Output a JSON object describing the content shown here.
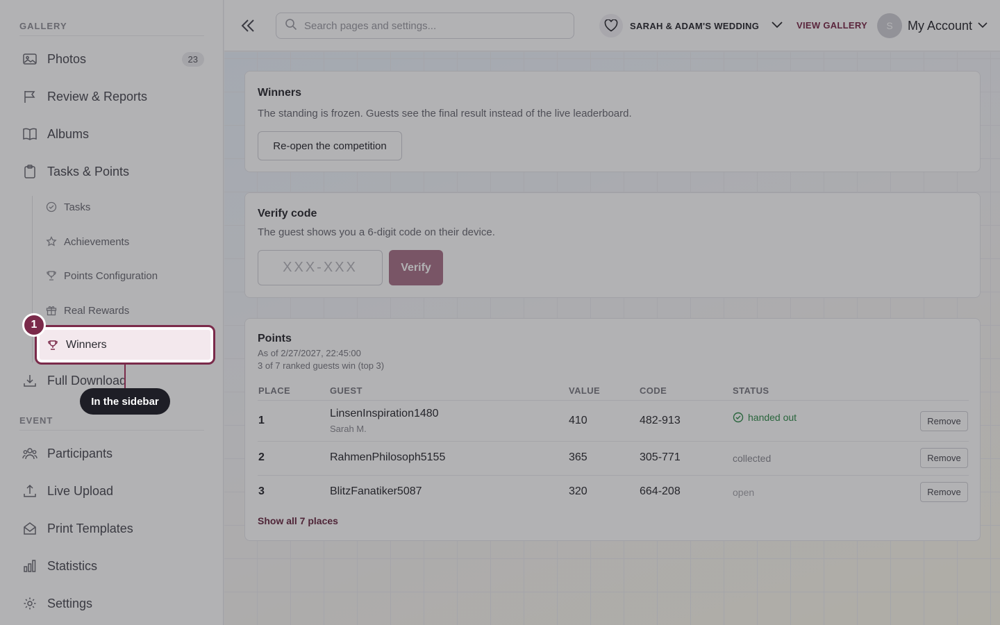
{
  "sidebar": {
    "gallery_label": "GALLERY",
    "event_label": "EVENT",
    "items": [
      {
        "label": "Photos",
        "badge": "23",
        "icon": "image-icon"
      },
      {
        "label": "Review & Reports",
        "icon": "flag-icon"
      },
      {
        "label": "Albums",
        "icon": "book-icon"
      },
      {
        "label": "Tasks & Points",
        "icon": "clipboard-icon"
      }
    ],
    "sub_items": [
      {
        "label": "Tasks",
        "icon": "check-circle-icon"
      },
      {
        "label": "Achievements",
        "icon": "star-icon"
      },
      {
        "label": "Points Configuration",
        "icon": "trophy-icon"
      },
      {
        "label": "Real Rewards",
        "icon": "gift-icon"
      },
      {
        "label": "Winners",
        "icon": "trophy-icon"
      }
    ],
    "full_download": "Full Download",
    "event_items": [
      {
        "label": "Participants",
        "icon": "users-icon"
      },
      {
        "label": "Live Upload",
        "icon": "upload-icon"
      },
      {
        "label": "Print Templates",
        "icon": "mail-icon"
      },
      {
        "label": "Statistics",
        "icon": "bar-chart-icon"
      },
      {
        "label": "Settings",
        "icon": "gear-icon"
      }
    ]
  },
  "topbar": {
    "search_placeholder": "Search pages and settings...",
    "event_name": "SARAH & ADAM'S WEDDING",
    "view_gallery": "VIEW GALLERY",
    "avatar_initial": "S",
    "account": "My Account"
  },
  "winners_card": {
    "title": "Winners",
    "description": "The standing is frozen. Guests see the final result instead of the live leaderboard.",
    "reopen_label": "Re-open the competition"
  },
  "verify_card": {
    "title": "Verify code",
    "description": "The guest shows you a 6-digit code on their device.",
    "input_placeholder": "XXX-XXX",
    "verify_label": "Verify"
  },
  "points_card": {
    "title": "Points",
    "as_of": "As of 2/27/2027, 22:45:00",
    "summary": "3 of 7 ranked guests win (top 3)",
    "columns": [
      "PLACE",
      "GUEST",
      "VALUE",
      "CODE",
      "STATUS"
    ],
    "rows": [
      {
        "place": "1",
        "guest": "LinsenInspiration1480",
        "guest_sub": "Sarah M.",
        "value": "410",
        "code": "482-913",
        "status": "handed out"
      },
      {
        "place": "2",
        "guest": "RahmenPhilosoph5155",
        "guest_sub": "",
        "value": "365",
        "code": "305-771",
        "status": "collected"
      },
      {
        "place": "3",
        "guest": "BlitzFanatiker5087",
        "guest_sub": "",
        "value": "320",
        "code": "664-208",
        "status": "open"
      }
    ],
    "remove_label": "Remove",
    "show_all": "Show all 7 places"
  },
  "tour": {
    "step": "1",
    "tooltip": "In the sidebar"
  },
  "colors": {
    "accent": "#7a2a4a",
    "verify_button": "#a97389",
    "status_green": "#2f8a4a"
  }
}
